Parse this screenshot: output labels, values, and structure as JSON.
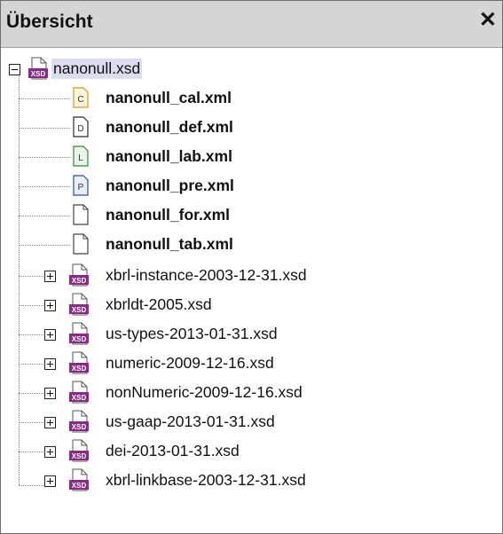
{
  "panel": {
    "title": "Übersicht",
    "close_glyph": "✕"
  },
  "tree": {
    "root": {
      "label": "nanonull.xsd",
      "icon": "xsd-file-icon",
      "expanded": true,
      "selected": true,
      "badge": "XSD",
      "children": [
        {
          "label": "nanonull_cal.xml",
          "icon": "calculation-linkbase-icon",
          "letter": "C"
        },
        {
          "label": "nanonull_def.xml",
          "icon": "definition-linkbase-icon",
          "letter": "D"
        },
        {
          "label": "nanonull_lab.xml",
          "icon": "label-linkbase-icon",
          "letter": "L"
        },
        {
          "label": "nanonull_pre.xml",
          "icon": "presentation-linkbase-icon",
          "letter": "P"
        },
        {
          "label": "nanonull_for.xml",
          "icon": "formula-file-icon",
          "letter": ""
        },
        {
          "label": "nanonull_tab.xml",
          "icon": "table-file-icon",
          "letter": ""
        }
      ]
    },
    "imports": [
      {
        "label": "xbrl-instance-2003-12-31.xsd"
      },
      {
        "label": "xbrldt-2005.xsd"
      },
      {
        "label": "us-types-2013-01-31.xsd"
      },
      {
        "label": "numeric-2009-12-16.xsd"
      },
      {
        "label": "nonNumeric-2009-12-16.xsd"
      },
      {
        "label": "us-gaap-2013-01-31.xsd"
      },
      {
        "label": "dei-2013-01-31.xsd"
      },
      {
        "label": "xbrl-linkbase-2003-12-31.xsd"
      }
    ]
  },
  "colors": {
    "header_bg": "#d5d5d5",
    "selection_bg": "#dcdcf0",
    "xsd_icon": "#8b2a86",
    "c_icon": "#c89a2a",
    "d_icon": "#2a2a2a",
    "l_icon": "#2a8a3a",
    "p_icon": "#2a4fa8"
  }
}
